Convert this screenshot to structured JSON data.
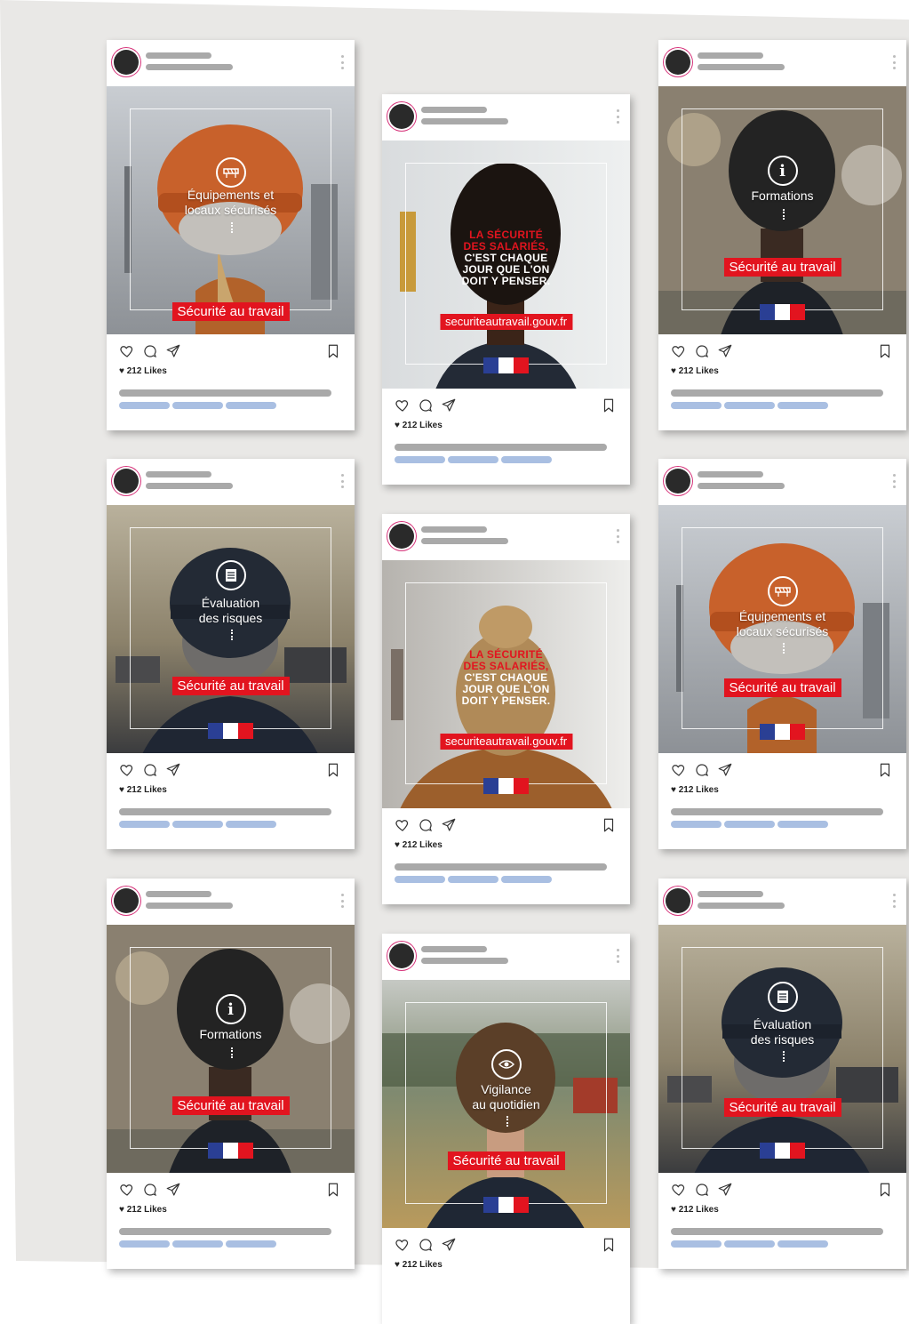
{
  "colors": {
    "accent_red": "#e2141f",
    "flag_blue": "#2a3f94",
    "avatar_ring": "#d6337a",
    "placeholder_gray": "#a9a9a9",
    "placeholder_blue": "#a9bfe2"
  },
  "common": {
    "likes_label": "♥ 212 Likes",
    "safety_label": "Sécurité au travail",
    "headline_red": [
      "LA SÉCURITÉ",
      "DES SALARIÉS,"
    ],
    "headline_white": [
      "C'EST CHAQUE",
      "JOUR QUE L'ON",
      "DOIT Y PENSER."
    ],
    "url": "securiteautravail.gouv.fr"
  },
  "posts": [
    {
      "icon": "barrier-icon",
      "topic": [
        "Équipements et",
        "locaux sécurisés"
      ],
      "subject": "orange hard hat"
    },
    {
      "icon": "none",
      "topic": [],
      "subject": "dark curly hair"
    },
    {
      "icon": "info-icon",
      "topic": [
        "Formations"
      ],
      "subject": "black bandana"
    },
    {
      "icon": "checklist-icon",
      "topic": [
        "Évaluation",
        "des risques"
      ],
      "subject": "black cap"
    },
    {
      "icon": "none",
      "topic": [],
      "subject": "blonde bun"
    },
    {
      "icon": "barrier-icon",
      "topic": [
        "Équipements et",
        "locaux sécurisés"
      ],
      "subject": "orange hard hat"
    },
    {
      "icon": "info-icon",
      "topic": [
        "Formations"
      ],
      "subject": "black bandana"
    },
    {
      "icon": "eye-icon",
      "topic": [
        "Vigilance",
        "au quotidien"
      ],
      "subject": "brown hair"
    },
    {
      "icon": "checklist-icon",
      "topic": [
        "Évaluation",
        "des risques"
      ],
      "subject": "black cap"
    }
  ]
}
